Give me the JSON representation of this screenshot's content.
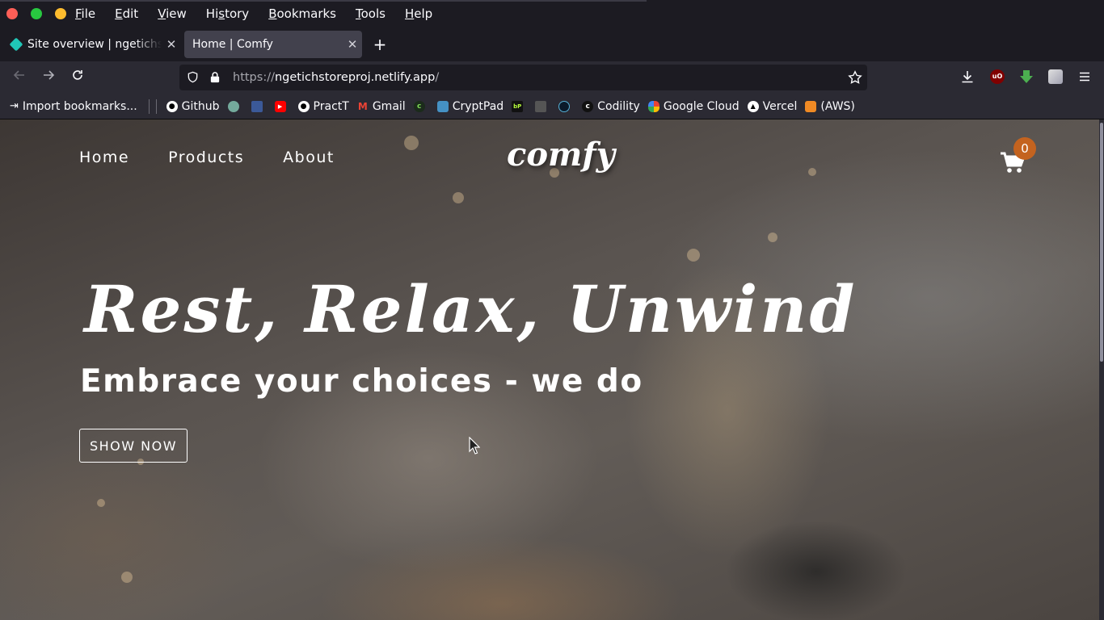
{
  "menubar": {
    "items": [
      "File",
      "Edit",
      "View",
      "History",
      "Bookmarks",
      "Tools",
      "Help"
    ],
    "accel": [
      "F",
      "E",
      "V",
      "s",
      "B",
      "T",
      "H"
    ]
  },
  "window_buttons": {
    "close": "#ff5f57",
    "maximize": "#28c840",
    "minimize": "#febc2e"
  },
  "tabs": [
    {
      "title": "Site overview | ngetichstorepro",
      "active": false,
      "icon": "netlify-icon"
    },
    {
      "title": "Home | Comfy",
      "active": true
    }
  ],
  "toolbar": {
    "url_scheme": "https://",
    "url_host": "ngetichstoreproj.netlify.app",
    "url_path": "/"
  },
  "bookmarks": {
    "import": "Import bookmarks...",
    "items": [
      {
        "label": "Github",
        "icon": "github-icon"
      },
      {
        "label": "",
        "icon": "chatgpt-icon"
      },
      {
        "label": "",
        "icon": "blue-app-icon"
      },
      {
        "label": "",
        "icon": "youtube-icon"
      },
      {
        "label": "PractT",
        "icon": "github-icon"
      },
      {
        "label": "Gmail",
        "icon": "gmail-icon"
      },
      {
        "label": "",
        "icon": "green-c-icon"
      },
      {
        "label": "CryptPad",
        "icon": "cryptpad-icon"
      },
      {
        "label": "",
        "icon": "bp-icon"
      },
      {
        "label": "",
        "icon": "stripe-icon"
      },
      {
        "label": "",
        "icon": "dark-circle-icon"
      },
      {
        "label": "Codility",
        "icon": "codility-icon"
      },
      {
        "label": "Google Cloud",
        "icon": "google-cloud-icon"
      },
      {
        "label": "Vercel",
        "icon": "vercel-icon"
      },
      {
        "label": "(AWS)",
        "icon": "aws-icon"
      }
    ]
  },
  "site": {
    "nav": [
      "Home",
      "Products",
      "About"
    ],
    "logo": "comfy",
    "cart_count": "0",
    "hero_title": "Rest, Relax, Unwind",
    "hero_subtitle": "Embrace your choices - we do",
    "hero_button": "SHOW NOW",
    "accent_color": "#c4631f"
  }
}
